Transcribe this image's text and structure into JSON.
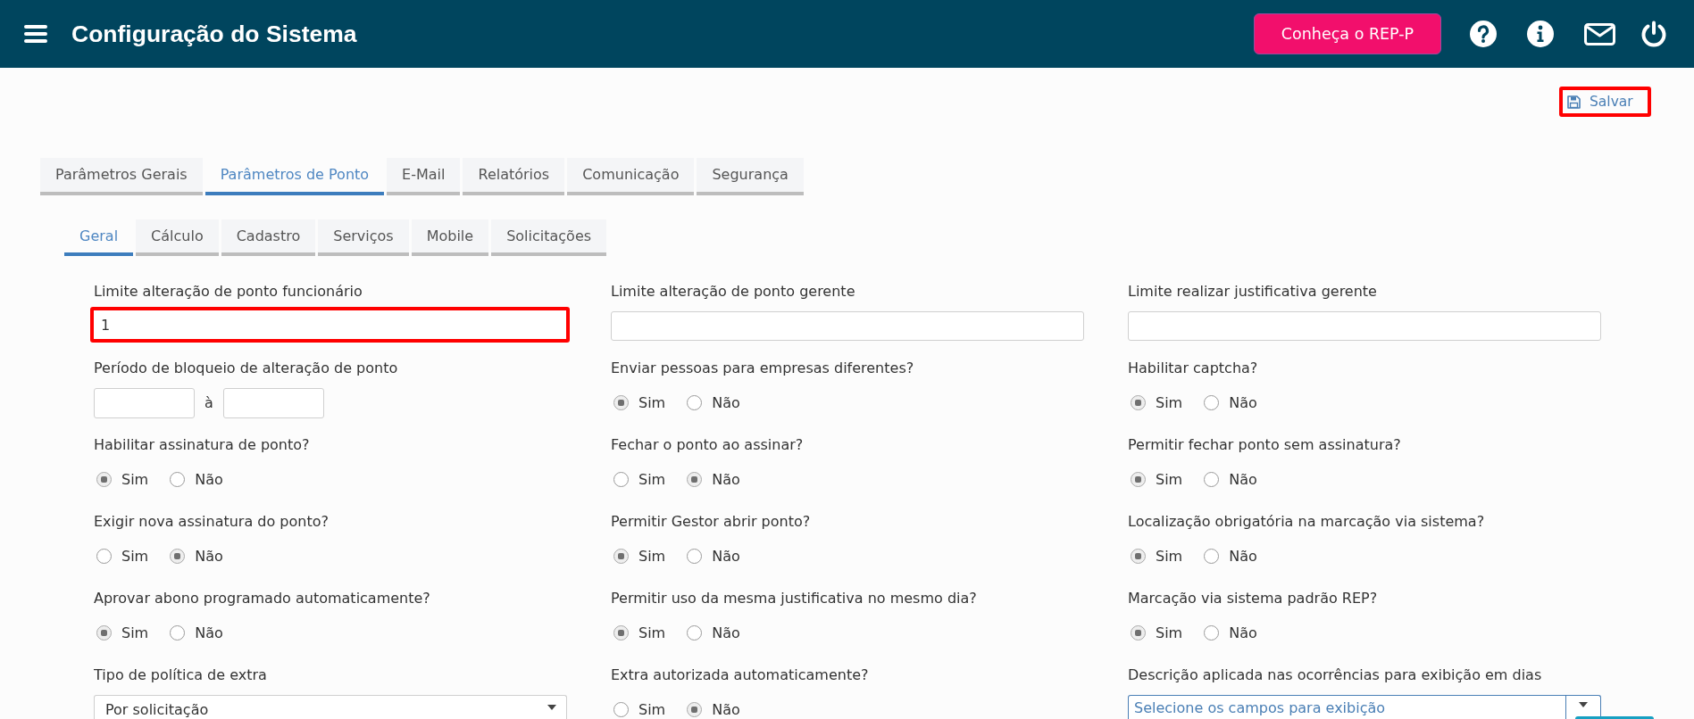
{
  "header": {
    "title": "Configuração do Sistema",
    "promo_button": "Conheça o REP-P"
  },
  "save_button": {
    "label": "Salvar",
    "highlighted": true
  },
  "tabs": [
    {
      "label": "Parâmetros Gerais",
      "selected": false
    },
    {
      "label": "Parâmetros de Ponto",
      "selected": true
    },
    {
      "label": "E-Mail",
      "selected": false
    },
    {
      "label": "Relatórios",
      "selected": false
    },
    {
      "label": "Comunicação",
      "selected": false
    },
    {
      "label": "Segurança",
      "selected": false
    }
  ],
  "subtabs": [
    {
      "label": "Geral",
      "selected": true
    },
    {
      "label": "Cálculo",
      "selected": false
    },
    {
      "label": "Cadastro",
      "selected": false
    },
    {
      "label": "Serviços",
      "selected": false
    },
    {
      "label": "Mobile",
      "selected": false
    },
    {
      "label": "Solicitações",
      "selected": false
    }
  ],
  "form": {
    "rows": [
      {
        "fields": [
          {
            "kind": "text",
            "label": "Limite alteração de ponto funcionário",
            "value": "1",
            "highlighted": true
          },
          {
            "kind": "text",
            "label": "Limite alteração de ponto gerente",
            "highlighted": false
          },
          {
            "kind": "text",
            "label": "Limite realizar justificativa gerente",
            "highlighted": false
          }
        ]
      },
      {
        "fields": [
          {
            "kind": "range",
            "label": "Período de bloqueio de alteração de ponto",
            "separator": "à"
          },
          {
            "kind": "radio",
            "label": "Enviar pessoas para empresas diferentes?",
            "options": [
              {
                "label": "Sim",
                "selected": true
              },
              {
                "label": "Não",
                "selected": false
              }
            ]
          },
          {
            "kind": "radio",
            "label": "Habilitar captcha?",
            "options": [
              {
                "label": "Sim",
                "selected": true
              },
              {
                "label": "Não",
                "selected": false
              }
            ]
          }
        ]
      },
      {
        "fields": [
          {
            "kind": "radio",
            "label": "Habilitar assinatura de ponto?",
            "options": [
              {
                "label": "Sim",
                "selected": true
              },
              {
                "label": "Não",
                "selected": false
              }
            ]
          },
          {
            "kind": "radio",
            "label": "Fechar o ponto ao assinar?",
            "options": [
              {
                "label": "Sim",
                "selected": false
              },
              {
                "label": "Não",
                "selected": true
              }
            ]
          },
          {
            "kind": "radio",
            "label": "Permitir fechar ponto sem assinatura?",
            "options": [
              {
                "label": "Sim",
                "selected": true
              },
              {
                "label": "Não",
                "selected": false
              }
            ]
          }
        ]
      },
      {
        "fields": [
          {
            "kind": "radio",
            "label": "Exigir nova assinatura do ponto?",
            "options": [
              {
                "label": "Sim",
                "selected": false
              },
              {
                "label": "Não",
                "selected": true
              }
            ]
          },
          {
            "kind": "radio",
            "label": "Permitir Gestor abrir ponto?",
            "options": [
              {
                "label": "Sim",
                "selected": true
              },
              {
                "label": "Não",
                "selected": false
              }
            ]
          },
          {
            "kind": "radio",
            "label": "Localização obrigatória na marcação via sistema?",
            "options": [
              {
                "label": "Sim",
                "selected": true
              },
              {
                "label": "Não",
                "selected": false
              }
            ]
          }
        ]
      },
      {
        "fields": [
          {
            "kind": "radio",
            "label": "Aprovar abono programado automaticamente?",
            "options": [
              {
                "label": "Sim",
                "selected": true
              },
              {
                "label": "Não",
                "selected": false
              }
            ]
          },
          {
            "kind": "radio",
            "label": "Permitir uso da mesma justificativa no mesmo dia?",
            "options": [
              {
                "label": "Sim",
                "selected": true
              },
              {
                "label": "Não",
                "selected": false
              }
            ]
          },
          {
            "kind": "radio",
            "label": "Marcação via sistema padrão REP?",
            "options": [
              {
                "label": "Sim",
                "selected": true
              },
              {
                "label": "Não",
                "selected": false
              }
            ]
          }
        ]
      },
      {
        "fields": [
          {
            "kind": "select",
            "label": "Tipo de política de extra",
            "value": "Por solicitação",
            "focused": false
          },
          {
            "kind": "radio",
            "label": "Extra autorizada automaticamente?",
            "options": [
              {
                "label": "Sim",
                "selected": false
              },
              {
                "label": "Não",
                "selected": true
              }
            ]
          },
          {
            "kind": "multiselect",
            "label": "Descrição aplicada nas ocorrências para exibição em dias",
            "placeholder": "Selecione os campos para exibição",
            "focused": true
          }
        ]
      }
    ]
  }
}
